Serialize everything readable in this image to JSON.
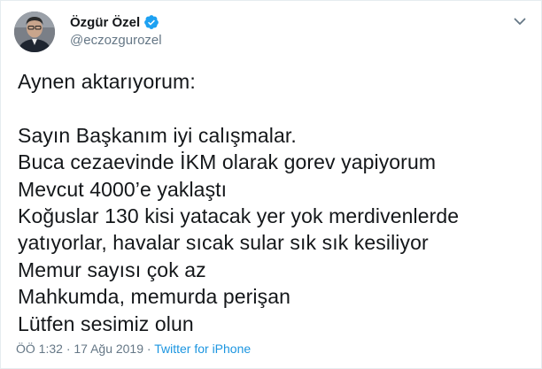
{
  "author": {
    "display_name": "Özgür Özel",
    "handle": "@eczozgurozel",
    "verified": true
  },
  "tweet": {
    "lines": [
      "Aynen aktarıyorum:",
      "",
      "Sayın Başkanım iyi calışmalar.",
      "Buca cezaevinde İKM olarak gorev yapiyorum",
      "Mevcut 4000’e yaklaştı",
      "Koğuslar 130 kisi yatacak yer yok merdivenlerde",
      "yatıyorlar, havalar sıcak sular sık sık kesiliyor",
      "Memur sayısı çok az",
      "Mahkumda, memurda perişan",
      "Lütfen sesimiz olun"
    ]
  },
  "meta": {
    "time": "ÖÖ 1:32",
    "separator": "·",
    "date": "17 Ağu 2019",
    "source": "Twitter for iPhone"
  },
  "colors": {
    "text": "#14171a",
    "secondary": "#657786",
    "link": "#1b95e0",
    "verified": "#1da1f2"
  },
  "icons": {
    "verified": "verified-badge-icon",
    "more": "chevron-down-icon"
  }
}
